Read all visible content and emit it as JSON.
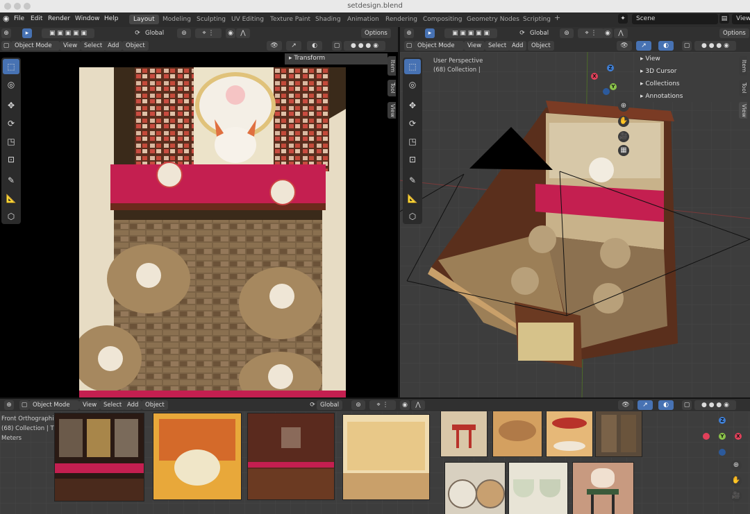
{
  "window": {
    "title": "setdesign.blend"
  },
  "menus": [
    "File",
    "Edit",
    "Render",
    "Window",
    "Help"
  ],
  "workspaces": [
    "Layout",
    "Modeling",
    "Sculpting",
    "UV Editing",
    "Texture Paint",
    "Shading",
    "Animation",
    "Rendering",
    "Compositing",
    "Geometry Nodes",
    "Scripting"
  ],
  "add_workspace": "+",
  "scene": {
    "label": "Scene",
    "view_layer": "View"
  },
  "left_view": {
    "mode": "Object Mode",
    "menu": [
      "View",
      "Select",
      "Add",
      "Object"
    ],
    "orientation": "Global",
    "options": "Options",
    "panel_title": "Transform",
    "tabs": [
      "Item",
      "Tool",
      "View"
    ]
  },
  "right_view": {
    "mode": "Object Mode",
    "menu": [
      "View",
      "Select",
      "Add",
      "Object"
    ],
    "orientation": "Global",
    "options": "Options",
    "overlay_line1": "User Perspective",
    "overlay_line2": "(68) Collection | ",
    "panel_items": [
      "View",
      "3D Cursor",
      "Collections",
      "Annotations"
    ],
    "tabs": [
      "Item",
      "Tool",
      "View"
    ]
  },
  "bottom_view": {
    "mode": "Object Mode",
    "menu": [
      "View",
      "Select",
      "Add",
      "Object"
    ],
    "orientation": "Global",
    "overlay_line1": "Front Orthographic",
    "overlay_line2": "(68) Collection | T",
    "overlay_line3": "Meters"
  },
  "gizmo": {
    "x": "X",
    "y": "Y",
    "z": "Z"
  },
  "colors": {
    "accent": "#4772b3",
    "x_axis": "#e2405a",
    "y_axis": "#8bc34a",
    "z_axis": "#3f7fd6",
    "counter_red": "#c41f50"
  }
}
